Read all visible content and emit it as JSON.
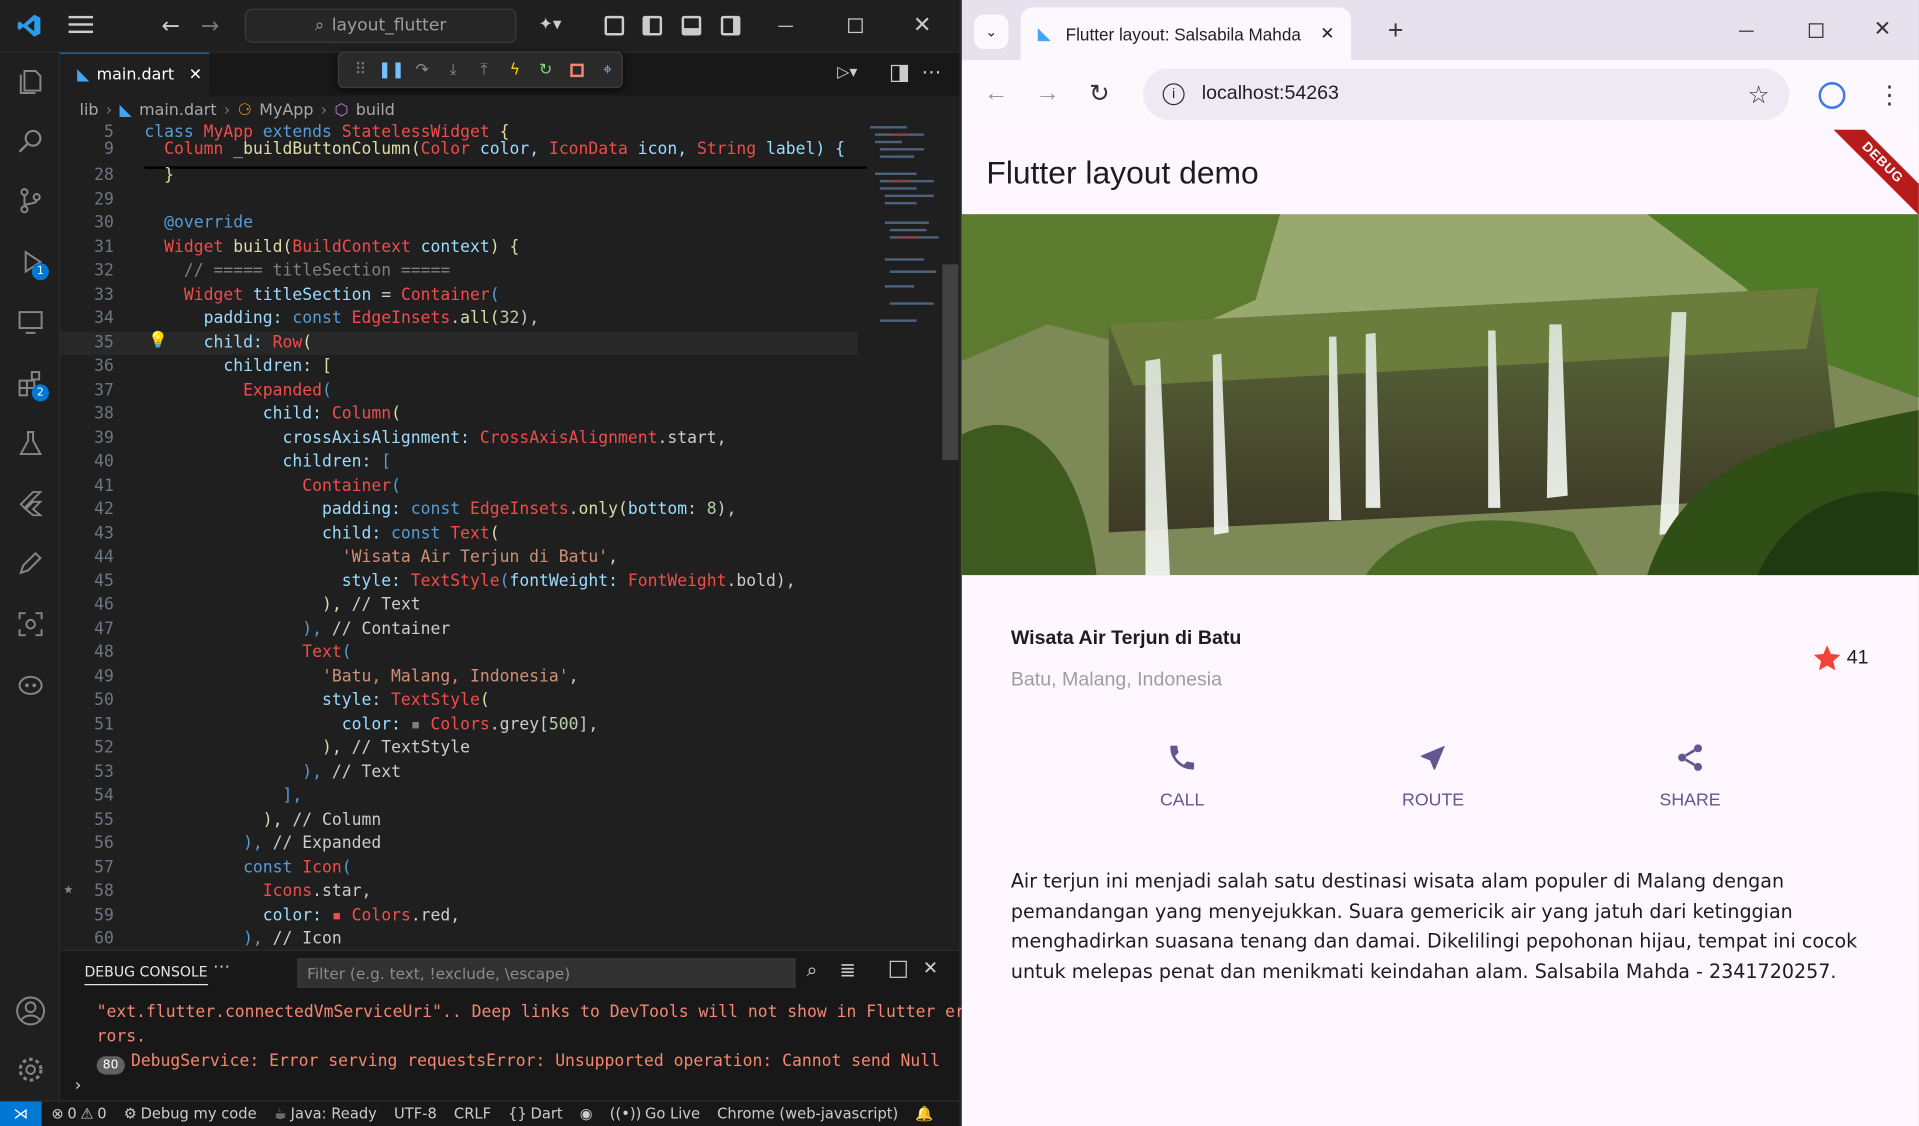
{
  "vscode": {
    "search_text": "layout_flutter",
    "tab_label": "main.dart",
    "breadcrumb": [
      "lib",
      "main.dart",
      "MyApp",
      "build"
    ],
    "sticky": [
      {
        "n": "5",
        "tokens": [
          [
            "class ",
            "c-kw"
          ],
          [
            "MyApp ",
            "c-cls"
          ],
          [
            "extends ",
            "c-kw"
          ],
          [
            "StatelessWidget ",
            "c-cls"
          ],
          [
            "{",
            "c-fn"
          ]
        ]
      },
      {
        "n": "9",
        "tokens": [
          [
            "  Column ",
            "c-cls"
          ],
          [
            "_buildButtonColumn",
            "c-fn"
          ],
          [
            "(",
            "c-fn"
          ],
          [
            "Color ",
            "c-cls"
          ],
          [
            "color, ",
            "c-prop"
          ],
          [
            "IconData ",
            "c-cls"
          ],
          [
            "icon, ",
            "c-prop"
          ],
          [
            "String ",
            "c-cls"
          ],
          [
            "label) {",
            "c-prop"
          ]
        ]
      }
    ],
    "lines": [
      {
        "n": "28",
        "tokens": [
          [
            "  }",
            "c-fn"
          ]
        ]
      },
      {
        "n": "29",
        "tokens": []
      },
      {
        "n": "30",
        "tokens": [
          [
            "  @override",
            "c-kw"
          ]
        ]
      },
      {
        "n": "31",
        "tokens": [
          [
            "  Widget ",
            "c-cls"
          ],
          [
            "build",
            "c-fn"
          ],
          [
            "(",
            "c-fn"
          ],
          [
            "BuildContext ",
            "c-cls"
          ],
          [
            "context",
            "c-prop"
          ],
          [
            ") {",
            "c-fn"
          ]
        ]
      },
      {
        "n": "32",
        "tokens": [
          [
            "    // ===== titleSection =====",
            "c-gr"
          ]
        ]
      },
      {
        "n": "33",
        "tokens": [
          [
            "    Widget ",
            "c-cls"
          ],
          [
            "titleSection ",
            "c-prop"
          ],
          [
            "= ",
            ""
          ],
          [
            "Container",
            "c-cls"
          ],
          [
            "(",
            "c-kw"
          ]
        ]
      },
      {
        "n": "34",
        "tokens": [
          [
            "      padding: ",
            "c-prop"
          ],
          [
            "const ",
            "c-kw"
          ],
          [
            "EdgeInsets",
            "c-cls"
          ],
          [
            ".",
            ""
          ],
          [
            "all",
            "c-fn"
          ],
          [
            "(",
            "c-fn"
          ],
          [
            "32",
            "c-num"
          ],
          [
            "),",
            ""
          ]
        ]
      },
      {
        "n": "35",
        "tokens": [
          [
            "      child: ",
            "c-prop"
          ],
          [
            "Row",
            "c-cls"
          ],
          [
            "(",
            "c-fn"
          ]
        ]
      },
      {
        "n": "36",
        "tokens": [
          [
            "        children: ",
            "c-prop"
          ],
          [
            "[",
            "c-fn"
          ]
        ]
      },
      {
        "n": "37",
        "tokens": [
          [
            "          Expanded",
            "c-cls"
          ],
          [
            "(",
            "c-kw"
          ]
        ]
      },
      {
        "n": "38",
        "tokens": [
          [
            "            child: ",
            "c-prop"
          ],
          [
            "Column",
            "c-cls"
          ],
          [
            "(",
            "c-fn"
          ]
        ]
      },
      {
        "n": "39",
        "tokens": [
          [
            "              crossAxisAlignment: ",
            "c-prop"
          ],
          [
            "CrossAxisAlignment",
            "c-cls"
          ],
          [
            ".start,",
            ""
          ]
        ]
      },
      {
        "n": "40",
        "tokens": [
          [
            "              children: ",
            "c-prop"
          ],
          [
            "[",
            "c-kw"
          ]
        ]
      },
      {
        "n": "41",
        "tokens": [
          [
            "                Container",
            "c-cls"
          ],
          [
            "(",
            "c-kw"
          ]
        ]
      },
      {
        "n": "42",
        "tokens": [
          [
            "                  padding: ",
            "c-prop"
          ],
          [
            "const ",
            "c-kw"
          ],
          [
            "EdgeInsets",
            "c-cls"
          ],
          [
            ".",
            ""
          ],
          [
            "only",
            "c-fn"
          ],
          [
            "(",
            "c-fn"
          ],
          [
            "bottom: ",
            "c-prop"
          ],
          [
            "8",
            "c-num"
          ],
          [
            "),",
            ""
          ]
        ]
      },
      {
        "n": "43",
        "tokens": [
          [
            "                  child: ",
            "c-prop"
          ],
          [
            "const ",
            "c-kw"
          ],
          [
            "Text",
            "c-cls"
          ],
          [
            "(",
            "c-fn"
          ]
        ]
      },
      {
        "n": "44",
        "tokens": [
          [
            "                    'Wisata Air Terjun di Batu'",
            "c-str"
          ],
          [
            ",",
            ""
          ]
        ]
      },
      {
        "n": "45",
        "tokens": [
          [
            "                    style: ",
            "c-prop"
          ],
          [
            "TextStyle",
            "c-cls"
          ],
          [
            "(",
            "c-kw"
          ],
          [
            "fontWeight: ",
            "c-prop"
          ],
          [
            "FontWeight",
            "c-cls"
          ],
          [
            ".bold),",
            ""
          ]
        ]
      },
      {
        "n": "46",
        "tokens": [
          [
            "                  ), ",
            "c-fn"
          ],
          [
            "// Text",
            ""
          ]
        ]
      },
      {
        "n": "47",
        "tokens": [
          [
            "                ), ",
            "c-kw"
          ],
          [
            "// Container",
            ""
          ]
        ]
      },
      {
        "n": "48",
        "tokens": [
          [
            "                Text",
            "c-cls"
          ],
          [
            "(",
            "c-kw"
          ]
        ]
      },
      {
        "n": "49",
        "tokens": [
          [
            "                  'Batu, Malang, Indonesia'",
            "c-str"
          ],
          [
            ",",
            ""
          ]
        ]
      },
      {
        "n": "50",
        "tokens": [
          [
            "                  style: ",
            "c-prop"
          ],
          [
            "TextStyle",
            "c-cls"
          ],
          [
            "(",
            "c-fn"
          ]
        ]
      },
      {
        "n": "51",
        "tokens": [
          [
            "                    color: ",
            "c-prop"
          ],
          [
            "▪ ",
            "c-gr"
          ],
          [
            "Colors",
            "c-cls"
          ],
          [
            ".grey[",
            ""
          ],
          [
            "500",
            "c-num"
          ],
          [
            "],",
            ""
          ]
        ]
      },
      {
        "n": "52",
        "tokens": [
          [
            "                  ), ",
            "c-fn"
          ],
          [
            "// TextStyle",
            ""
          ]
        ]
      },
      {
        "n": "53",
        "tokens": [
          [
            "                ), ",
            "c-kw"
          ],
          [
            "// Text",
            ""
          ]
        ]
      },
      {
        "n": "54",
        "tokens": [
          [
            "              ],",
            "c-kw"
          ]
        ]
      },
      {
        "n": "55",
        "tokens": [
          [
            "            ), ",
            "c-fn"
          ],
          [
            "// Column",
            ""
          ]
        ]
      },
      {
        "n": "56",
        "tokens": [
          [
            "          ), ",
            "c-kw"
          ],
          [
            "// Expanded",
            ""
          ]
        ]
      },
      {
        "n": "57",
        "tokens": [
          [
            "          const ",
            "c-kw"
          ],
          [
            "Icon",
            "c-cls"
          ],
          [
            "(",
            "c-kw"
          ]
        ]
      },
      {
        "n": "58",
        "tokens": [
          [
            "            Icons",
            "c-cls"
          ],
          [
            ".star,",
            ""
          ]
        ]
      },
      {
        "n": "59",
        "tokens": [
          [
            "            color: ",
            "c-prop"
          ],
          [
            "▪ ",
            "c-cls"
          ],
          [
            "Colors",
            "c-cls"
          ],
          [
            ".red,",
            ""
          ]
        ]
      },
      {
        "n": "60",
        "tokens": [
          [
            "          ), ",
            "c-kw"
          ],
          [
            "// Icon",
            ""
          ]
        ]
      }
    ],
    "panel": {
      "tab": "DEBUG CONSOLE",
      "filter_placeholder": "Filter (e.g. text, !exclude, \\escape)",
      "line1": "\"ext.flutter.connectedVmServiceUri\".. Deep links to DevTools will not show in Flutter er",
      "line2": "rors.",
      "count": "80",
      "line3": "DebugService: Error serving requestsError: Unsupported operation: Cannot send Null"
    },
    "status": {
      "errors": "0",
      "warnings": "0",
      "debug": "Debug my code",
      "java": "Java: Ready",
      "encoding": "UTF-8",
      "eol": "CRLF",
      "lang": "Dart",
      "golive": "Go Live",
      "device": "Chrome (web-javascript)"
    },
    "badges": {
      "debug": "1",
      "extensions": "2"
    }
  },
  "chrome": {
    "tab_title": "Flutter layout: Salsabila Mahda",
    "url": "localhost:54263"
  },
  "flutter_app": {
    "title": "Flutter layout demo",
    "debug_banner": "DEBUG",
    "place_title": "Wisata Air Terjun di Batu",
    "place_location": "Batu, Malang, Indonesia",
    "star_count": "41",
    "buttons": [
      "CALL",
      "ROUTE",
      "SHARE"
    ],
    "description": "Air terjun ini menjadi salah satu destinasi wisata alam populer di Malang dengan pemandangan yang menyejukkan. Suara gemericik air yang jatuh dari ketinggian menghadirkan suasana tenang dan damai. Dikelilingi pepohonan hijau, tempat ini cocok untuk melepas penat dan menikmati keindahan alam. Salsabila Mahda - 2341720257.",
    "accent_color": "#65558f",
    "star_color": "#f44336"
  }
}
